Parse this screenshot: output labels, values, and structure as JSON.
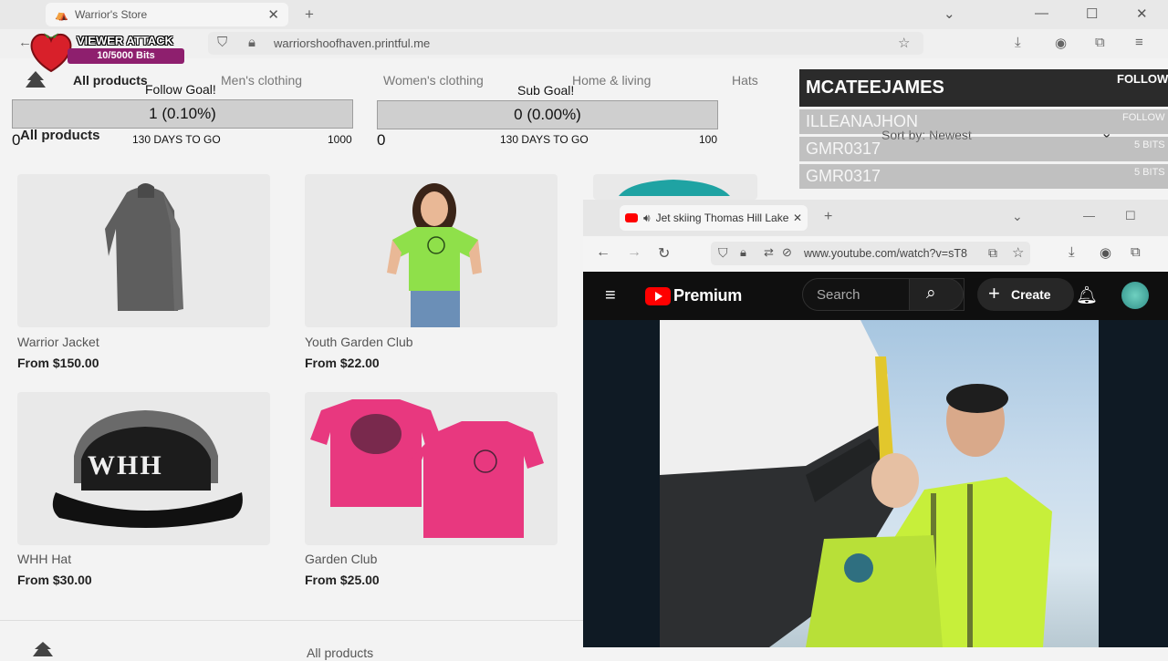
{
  "browser": {
    "tab_title": "Warrior's Store",
    "url_domain": "warriorshoofhaven.printful.me",
    "new_tab_symbol": "+"
  },
  "store": {
    "nav": [
      "All products",
      "Men's clothing",
      "Women's clothing",
      "Home & living",
      "Hats"
    ],
    "heading": "All products",
    "sort_label": "Sort by: Newest",
    "footer_link": "All products",
    "products": [
      {
        "name": "Warrior Jacket",
        "price": "From $150.00"
      },
      {
        "name": "Youth Garden Club",
        "price": "From $22.00"
      },
      {
        "name": "WHH Hat",
        "price": "From $30.00"
      },
      {
        "name": "Garden Club",
        "price": "From $25.00"
      }
    ],
    "hat_text": "WHH"
  },
  "overlay": {
    "viewer_attack": {
      "title": "VIEWER ATTACK",
      "progress": "10/5000 Bits"
    },
    "follow_goal": {
      "title": "Follow Goal!",
      "value": "1 (0.10%)",
      "start": "0",
      "days": "130 DAYS TO GO",
      "target": "1000"
    },
    "sub_goal": {
      "title": "Sub Goal!",
      "value": "0 (0.00%)",
      "start": "0",
      "days": "130 DAYS TO GO",
      "target": "100"
    },
    "alerts": [
      {
        "name": "MCATEEJAMES",
        "tag": "FOLLOW"
      },
      {
        "name": "ILLEANAJHON",
        "tag": "FOLLOW"
      },
      {
        "name": "GMR0317",
        "tag": "5 BITS"
      },
      {
        "name": "GMR0317",
        "tag": "5 BITS"
      }
    ]
  },
  "youtube": {
    "tab_title": "Jet skiing Thomas Hill Lake",
    "url": "www.youtube.com/watch?v=sT8",
    "logo_text": "Premium",
    "search_placeholder": "Search",
    "create_label": "Create"
  },
  "colors": {
    "youtube_red": "#ff0000",
    "alert_dark": "#2b2b2b",
    "attack_purple": "#8e1f6e",
    "lime_shirt": "#8fe04a",
    "pink_shirt": "#e8387f"
  }
}
